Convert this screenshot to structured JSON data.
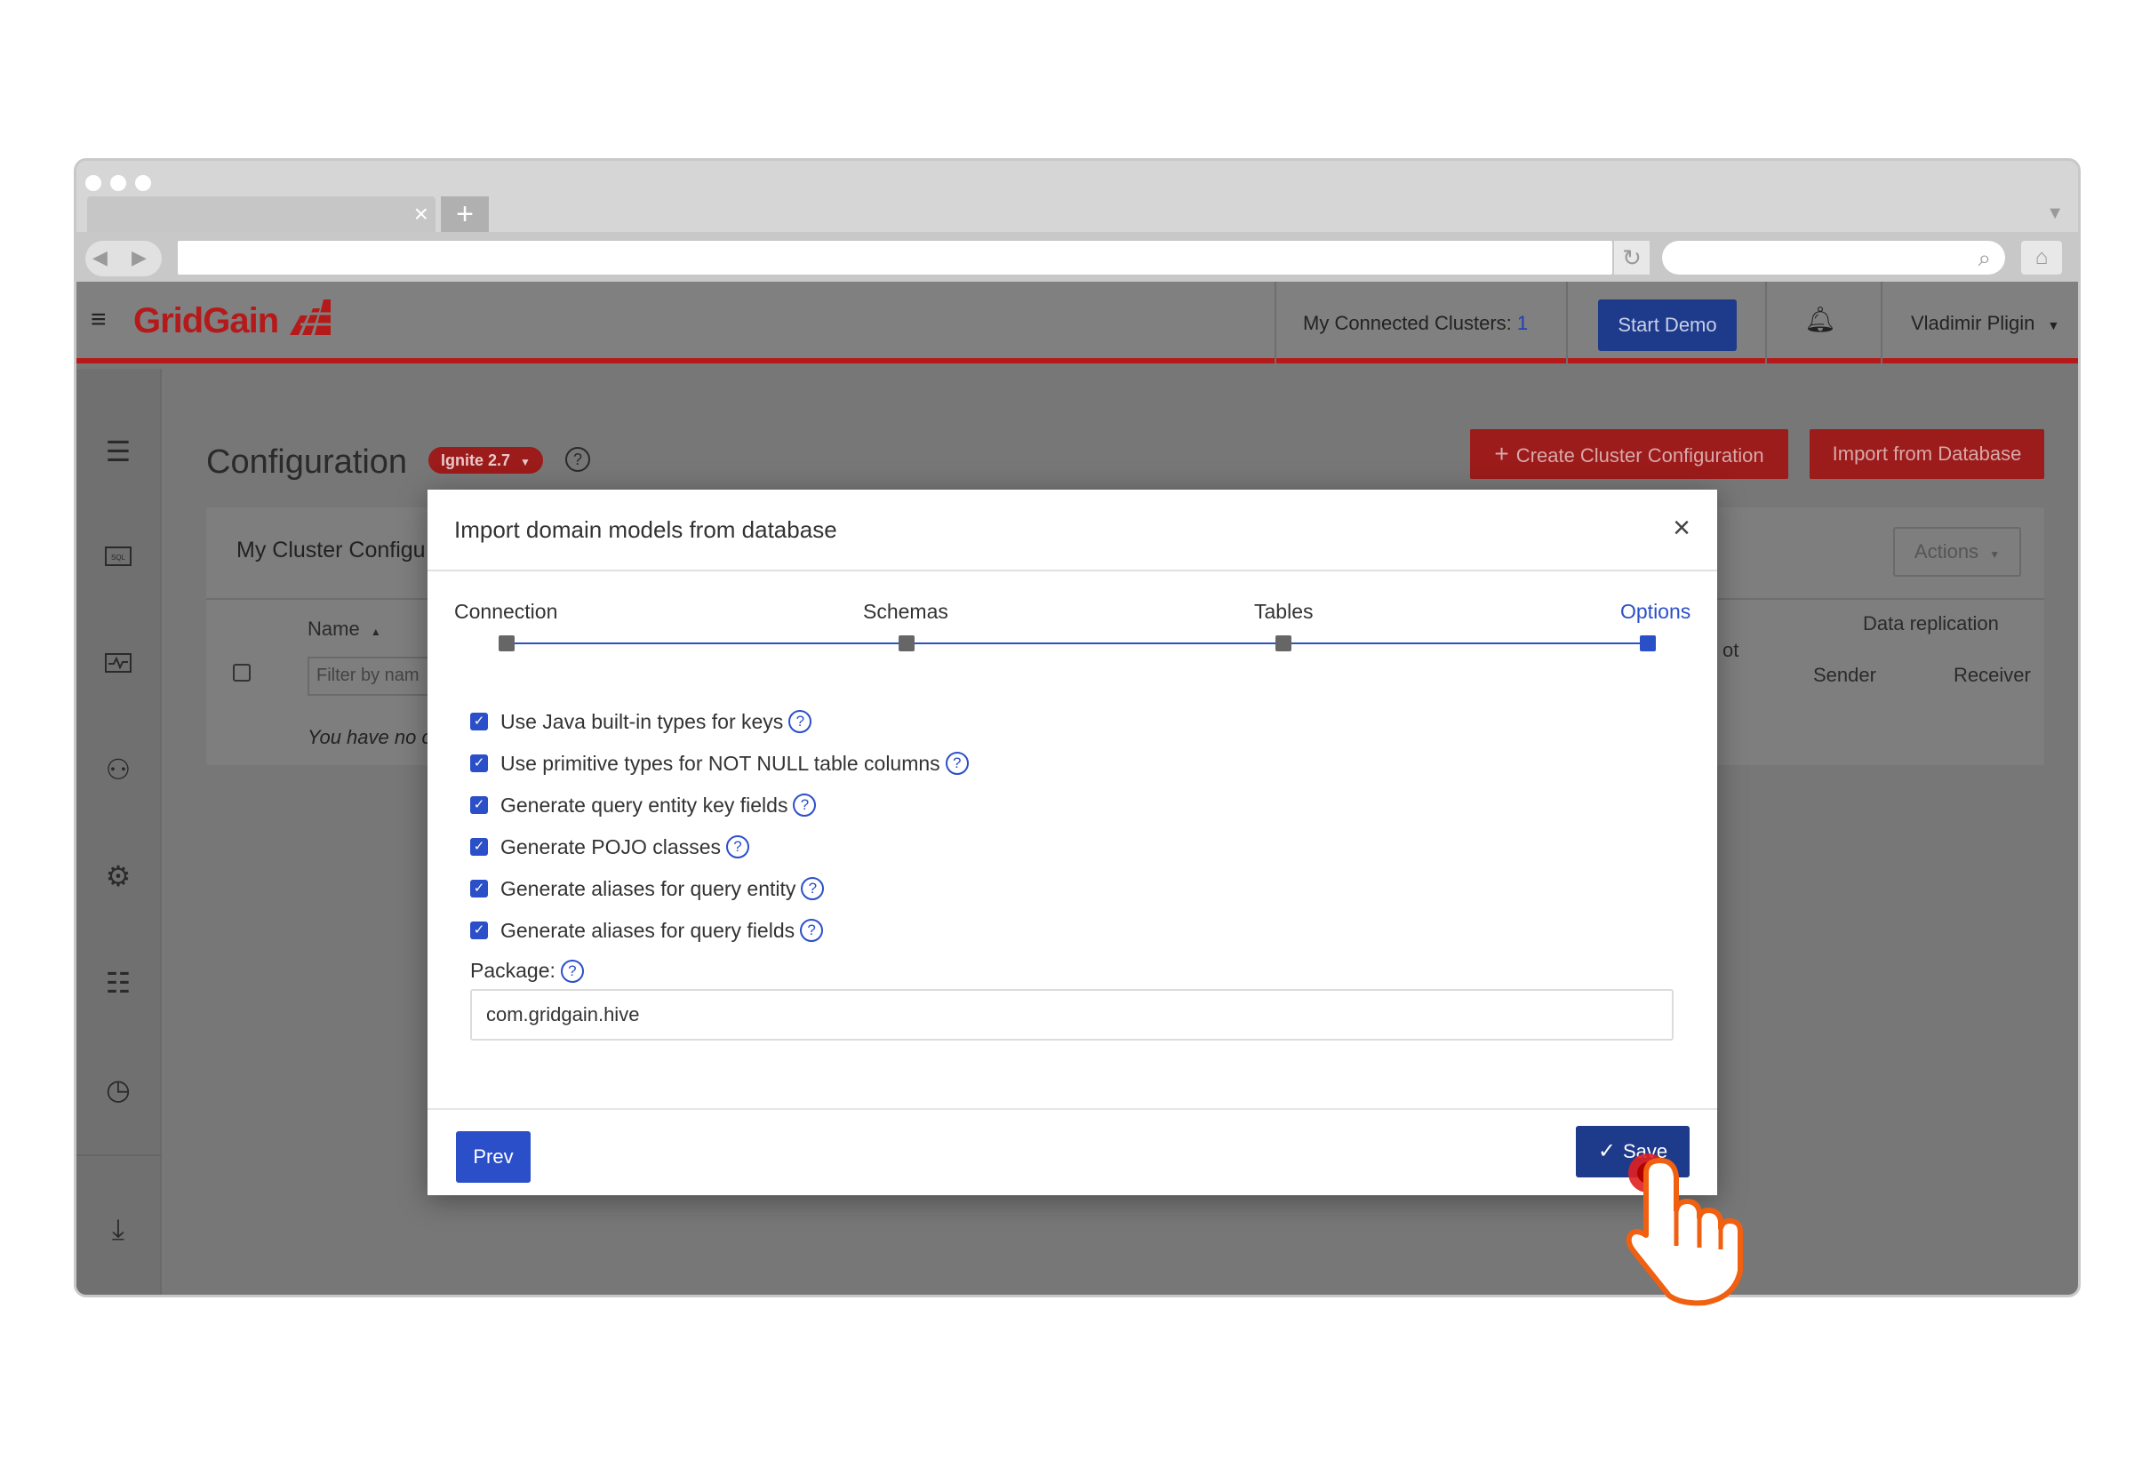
{
  "browser": {
    "new_tab_label": "+",
    "tab_close": "×"
  },
  "header": {
    "logo_text": "GridGain",
    "connected_clusters_label": "My Connected Clusters:",
    "connected_clusters_count": "1",
    "start_demo_label": "Start Demo",
    "user_name": "Vladimir Pligin"
  },
  "page": {
    "title": "Configuration",
    "version_badge": "Ignite 2.7",
    "create_button": "Create Cluster Configuration",
    "import_button": "Import from Database"
  },
  "card": {
    "title": "My Cluster Configu",
    "actions_label": "Actions",
    "name_column": "Name",
    "filter_placeholder": "Filter by nam",
    "empty_text": "You have no cl",
    "snapshot_fragment": "ot",
    "data_replication": "Data replication",
    "sender": "Sender",
    "receiver": "Receiver"
  },
  "modal": {
    "title": "Import domain models from database",
    "steps": [
      {
        "label": "Connection",
        "active": false
      },
      {
        "label": "Schemas",
        "active": false
      },
      {
        "label": "Tables",
        "active": false
      },
      {
        "label": "Options",
        "active": true
      }
    ],
    "options": [
      {
        "label": "Use Java built-in types for keys",
        "checked": true
      },
      {
        "label": "Use primitive types for NOT NULL table columns",
        "checked": true
      },
      {
        "label": "Generate query entity key fields",
        "checked": true
      },
      {
        "label": "Generate POJO classes",
        "checked": true
      },
      {
        "label": "Generate aliases for query entity",
        "checked": true
      },
      {
        "label": "Generate aliases for query fields",
        "checked": true
      }
    ],
    "package_label": "Package:",
    "package_value": "com.gridgain.hive",
    "prev_button": "Prev",
    "save_button": "Save"
  },
  "colors": {
    "brand_red": "#b51a1a",
    "primary_blue": "#2b4fc9",
    "dark_blue": "#1e3a8a"
  }
}
